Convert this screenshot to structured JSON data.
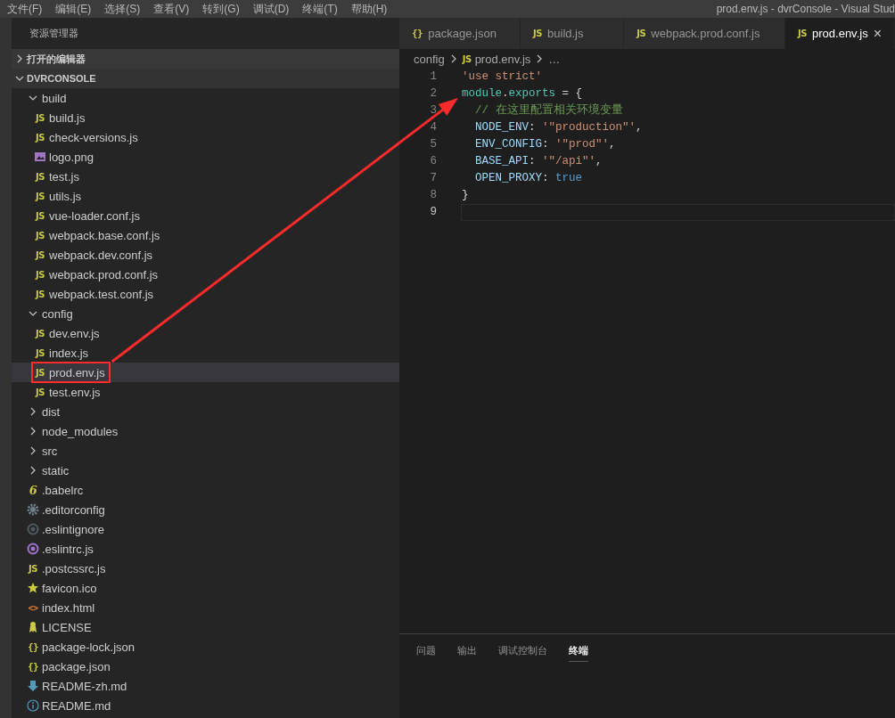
{
  "menu_bar": {
    "items": [
      "文件(F)",
      "编辑(E)",
      "选择(S)",
      "查看(V)",
      "转到(G)",
      "调试(D)",
      "终端(T)",
      "帮助(H)"
    ],
    "title": "prod.env.js - dvrConsole - Visual Stud"
  },
  "sidebar": {
    "title": "资源管理器",
    "sections": [
      {
        "label": "打开的编辑器",
        "expanded": false
      },
      {
        "label": "DVRCONSOLE",
        "expanded": true
      }
    ],
    "tree": [
      {
        "kind": "folder",
        "name": "build",
        "expanded": true,
        "selected": false,
        "marked": false,
        "children": [
          {
            "kind": "js",
            "icon": "JS",
            "name": "build.js",
            "selected": false,
            "marked": false
          },
          {
            "kind": "js",
            "icon": "JS",
            "name": "check-versions.js",
            "selected": false,
            "marked": false
          },
          {
            "kind": "image",
            "name": "logo.png",
            "selected": false,
            "marked": false
          },
          {
            "kind": "js",
            "icon": "JS",
            "name": "test.js",
            "selected": false,
            "marked": false
          },
          {
            "kind": "js",
            "icon": "JS",
            "name": "utils.js",
            "selected": false,
            "marked": false
          },
          {
            "kind": "js",
            "icon": "JS",
            "name": "vue-loader.conf.js",
            "selected": false,
            "marked": false
          },
          {
            "kind": "js",
            "icon": "JS",
            "name": "webpack.base.conf.js",
            "selected": false,
            "marked": false
          },
          {
            "kind": "js",
            "icon": "JS",
            "name": "webpack.dev.conf.js",
            "selected": false,
            "marked": false
          },
          {
            "kind": "js",
            "icon": "JS",
            "name": "webpack.prod.conf.js",
            "selected": false,
            "marked": false
          },
          {
            "kind": "js",
            "icon": "JS",
            "name": "webpack.test.conf.js",
            "selected": false,
            "marked": false
          }
        ]
      },
      {
        "kind": "folder",
        "name": "config",
        "expanded": true,
        "selected": false,
        "marked": false,
        "children": [
          {
            "kind": "js",
            "icon": "JS",
            "name": "dev.env.js",
            "selected": false,
            "marked": false
          },
          {
            "kind": "js",
            "icon": "JS",
            "name": "index.js",
            "selected": false,
            "marked": false
          },
          {
            "kind": "js",
            "icon": "JS",
            "name": "prod.env.js",
            "selected": true,
            "marked": true
          },
          {
            "kind": "js",
            "icon": "JS",
            "name": "test.env.js",
            "selected": false,
            "marked": false
          }
        ]
      },
      {
        "kind": "folder",
        "name": "dist",
        "expanded": false,
        "selected": false,
        "marked": false
      },
      {
        "kind": "folder",
        "name": "node_modules",
        "expanded": false,
        "selected": false,
        "marked": false
      },
      {
        "kind": "folder",
        "name": "src",
        "expanded": false,
        "selected": false,
        "marked": false
      },
      {
        "kind": "folder",
        "name": "static",
        "expanded": false,
        "selected": false,
        "marked": false
      },
      {
        "kind": "babel",
        "icon": "6",
        "name": ".babelrc",
        "selected": false,
        "marked": false
      },
      {
        "kind": "gear",
        "name": ".editorconfig",
        "selected": false,
        "marked": false
      },
      {
        "kind": "ignore",
        "name": ".eslintignore",
        "selected": false,
        "marked": false
      },
      {
        "kind": "eslint",
        "name": ".eslintrc.js",
        "selected": false,
        "marked": false
      },
      {
        "kind": "js",
        "icon": "JS",
        "name": ".postcssrc.js",
        "selected": false,
        "marked": false
      },
      {
        "kind": "star",
        "name": "favicon.ico",
        "selected": false,
        "marked": false
      },
      {
        "kind": "html",
        "icon": "<>",
        "name": "index.html",
        "selected": false,
        "marked": false
      },
      {
        "kind": "license",
        "name": "LICENSE",
        "selected": false,
        "marked": false
      },
      {
        "kind": "json",
        "icon": "{}",
        "name": "package-lock.json",
        "selected": false,
        "marked": false
      },
      {
        "kind": "json",
        "icon": "{}",
        "name": "package.json",
        "selected": false,
        "marked": false
      },
      {
        "kind": "markdown",
        "name": "README-zh.md",
        "selected": false,
        "marked": false
      },
      {
        "kind": "info",
        "name": "README.md",
        "selected": false,
        "marked": false
      }
    ]
  },
  "editor": {
    "tabs": [
      {
        "kind": "json",
        "icon": "{}",
        "label": "package.json",
        "selected": false
      },
      {
        "kind": "js",
        "icon": "JS",
        "label": "build.js",
        "selected": false
      },
      {
        "kind": "js",
        "icon": "JS",
        "label": "webpack.prod.conf.js",
        "selected": false
      },
      {
        "kind": "js",
        "icon": "JS",
        "label": "prod.env.js",
        "selected": true,
        "close": "×"
      }
    ],
    "breadcrumb": {
      "folder": "config",
      "file_icon": "JS",
      "file": "prod.env.js",
      "more": "…"
    },
    "lines": [
      {
        "number": "1",
        "indented": false,
        "current": false,
        "tokens": [
          {
            "kind": "string",
            "text": "'use strict'"
          }
        ]
      },
      {
        "number": "2",
        "indented": false,
        "current": false,
        "tokens": [
          {
            "kind": "variable",
            "text": "module"
          },
          {
            "kind": "punct",
            "text": "."
          },
          {
            "kind": "variable",
            "text": "exports"
          },
          {
            "kind": "punct",
            "text": " = {"
          }
        ]
      },
      {
        "number": "3",
        "indented": true,
        "current": false,
        "tokens": [
          {
            "kind": "comment",
            "text": "// 在这里配置相关环境变量"
          }
        ]
      },
      {
        "number": "4",
        "indented": true,
        "current": false,
        "tokens": [
          {
            "kind": "property",
            "text": "NODE_ENV"
          },
          {
            "kind": "punct",
            "text": ": "
          },
          {
            "kind": "string",
            "text": "'\"production\"'"
          },
          {
            "kind": "punct",
            "text": ","
          }
        ]
      },
      {
        "number": "5",
        "indented": true,
        "current": false,
        "tokens": [
          {
            "kind": "property",
            "text": "ENV_CONFIG"
          },
          {
            "kind": "punct",
            "text": ": "
          },
          {
            "kind": "string",
            "text": "'\"prod\"'"
          },
          {
            "kind": "punct",
            "text": ","
          }
        ]
      },
      {
        "number": "6",
        "indented": true,
        "current": false,
        "tokens": [
          {
            "kind": "property",
            "text": "BASE_API"
          },
          {
            "kind": "punct",
            "text": ": "
          },
          {
            "kind": "string",
            "text": "'\"/api\"'"
          },
          {
            "kind": "punct",
            "text": ","
          }
        ]
      },
      {
        "number": "7",
        "indented": true,
        "current": false,
        "tokens": [
          {
            "kind": "property",
            "text": "OPEN_PROXY"
          },
          {
            "kind": "punct",
            "text": ": "
          },
          {
            "kind": "boolean",
            "text": "true"
          }
        ]
      },
      {
        "number": "8",
        "indented": false,
        "current": false,
        "tokens": [
          {
            "kind": "punct",
            "text": "}"
          }
        ]
      },
      {
        "number": "9",
        "indented": false,
        "current": true
      }
    ]
  },
  "panel": {
    "tabs": [
      {
        "label": "问题",
        "selected": false
      },
      {
        "label": "输出",
        "selected": false
      },
      {
        "label": "调试控制台",
        "selected": false
      },
      {
        "label": "终端",
        "selected": true
      }
    ]
  }
}
